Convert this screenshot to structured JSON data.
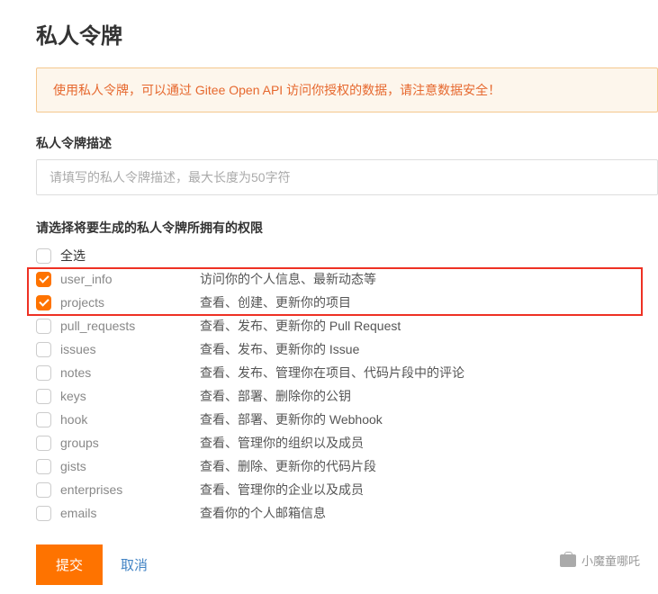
{
  "title": "私人令牌",
  "notice": {
    "prefix": "使用私人令牌，可以通过 ",
    "link": "Gitee Open API",
    "suffix": " 访问你授权的数据，请注意数据安全！"
  },
  "desc": {
    "label": "私人令牌描述",
    "placeholder": "请填写的私人令牌描述，最大长度为50字符"
  },
  "perm": {
    "label": "请选择将要生成的私人令牌所拥有的权限",
    "select_all": "全选",
    "items": [
      {
        "key": "user_info",
        "desc": "访问你的个人信息、最新动态等",
        "checked": true
      },
      {
        "key": "projects",
        "desc": "查看、创建、更新你的项目",
        "checked": true
      },
      {
        "key": "pull_requests",
        "desc": "查看、发布、更新你的 Pull Request",
        "checked": false
      },
      {
        "key": "issues",
        "desc": "查看、发布、更新你的 Issue",
        "checked": false
      },
      {
        "key": "notes",
        "desc": "查看、发布、管理你在项目、代码片段中的评论",
        "checked": false
      },
      {
        "key": "keys",
        "desc": "查看、部署、删除你的公钥",
        "checked": false
      },
      {
        "key": "hook",
        "desc": "查看、部署、更新你的 Webhook",
        "checked": false
      },
      {
        "key": "groups",
        "desc": "查看、管理你的组织以及成员",
        "checked": false
      },
      {
        "key": "gists",
        "desc": "查看、删除、更新你的代码片段",
        "checked": false
      },
      {
        "key": "enterprises",
        "desc": "查看、管理你的企业以及成员",
        "checked": false
      },
      {
        "key": "emails",
        "desc": "查看你的个人邮箱信息",
        "checked": false
      }
    ]
  },
  "actions": {
    "submit": "提交",
    "cancel": "取消"
  },
  "watermark": "小魔童哪吒"
}
